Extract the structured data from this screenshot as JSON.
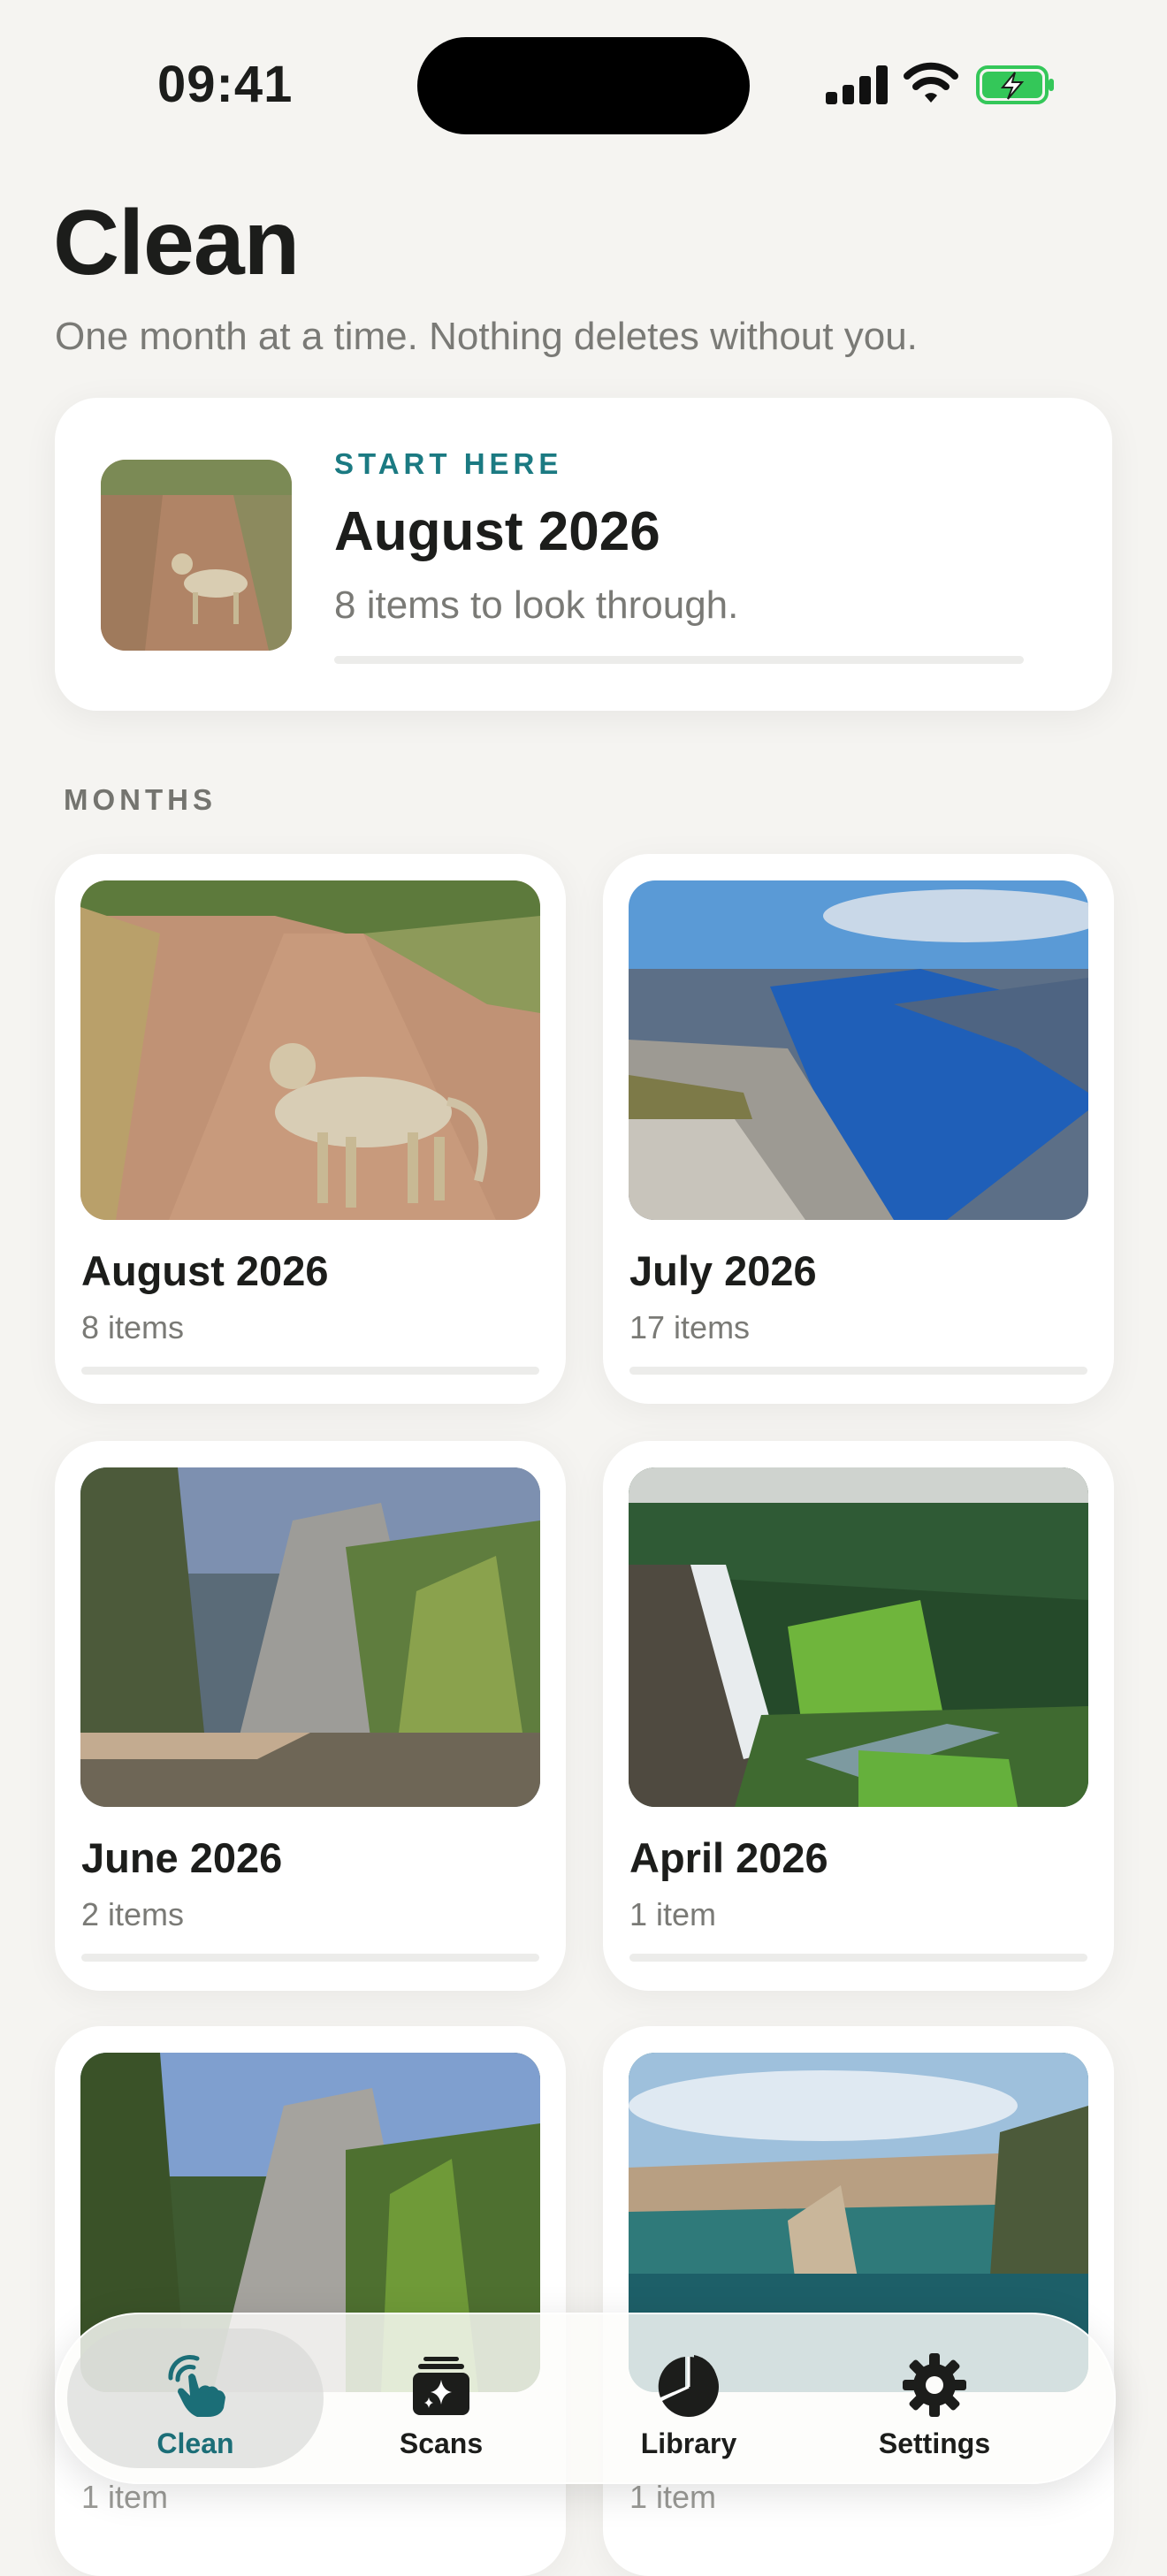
{
  "status_bar": {
    "time": "09:41",
    "icons": [
      "cellular-signal-icon",
      "wifi-icon",
      "battery-charging-icon"
    ]
  },
  "header": {
    "title": "Clean",
    "subtitle": "One month at a time. Nothing deletes without you."
  },
  "start_card": {
    "eyebrow": "START HERE",
    "month": "August 2026",
    "count_text": "8 items to look through.",
    "progress": 0.0
  },
  "section": {
    "label": "MONTHS"
  },
  "months": [
    {
      "name": "August 2026",
      "count": "8 items",
      "progress": 0.0,
      "photo": "leopard-on-dirt-road"
    },
    {
      "name": "July 2026",
      "count": "17 items",
      "progress": 0.0,
      "photo": "fjord-cliff"
    },
    {
      "name": "June 2026",
      "count": "2 items",
      "progress": 0.0,
      "photo": "blurred-forest-cliff"
    },
    {
      "name": "April 2026",
      "count": "1 item",
      "progress": 0.0,
      "photo": "waterfall-forest"
    },
    {
      "name": "",
      "count": "1 item",
      "progress": 0.0,
      "photo": "forest-granite-cliff"
    },
    {
      "name": "",
      "count": "1 item",
      "progress": 0.0,
      "photo": "sea-cliffs"
    }
  ],
  "tabbar": {
    "tabs": [
      {
        "label": "Clean",
        "icon": "tap-hand-icon",
        "active": true
      },
      {
        "label": "Scans",
        "icon": "sparkle-stack-icon",
        "active": false
      },
      {
        "label": "Library",
        "icon": "pie-chart-icon",
        "active": false
      },
      {
        "label": "Settings",
        "icon": "gear-icon",
        "active": false
      }
    ]
  },
  "colors": {
    "accent": "#1b7a82",
    "background": "#f5f4f1",
    "card": "#ffffff",
    "battery": "#34c759"
  }
}
